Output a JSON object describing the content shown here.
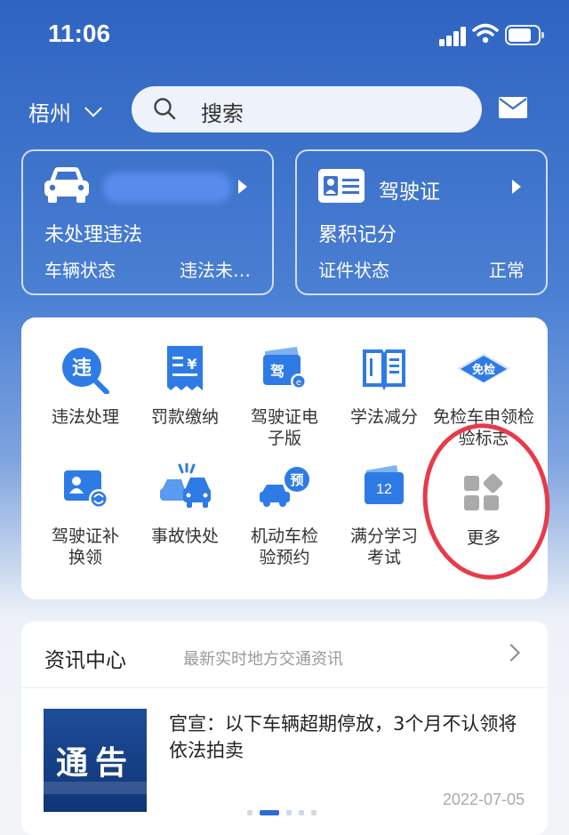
{
  "status_bar": {
    "time": "11:06",
    "battery_level": 0.8
  },
  "header": {
    "city": "梧州",
    "search_placeholder": "搜索"
  },
  "vehicle_card": {
    "title": "未处理违法",
    "status_label": "车辆状态",
    "status_value": "违法未…"
  },
  "license_card": {
    "name": "驾驶证",
    "title": "累积记分",
    "status_label": "证件状态",
    "status_value": "正常"
  },
  "services": [
    {
      "label": "违法处理",
      "icon": "violation-icon"
    },
    {
      "label": "罚款缴纳",
      "icon": "fine-payment-icon"
    },
    {
      "label": "驾驶证电子版",
      "icon": "e-license-icon"
    },
    {
      "label": "学法减分",
      "icon": "study-book-icon"
    },
    {
      "label": "免检车申领检验标志",
      "icon": "inspection-exempt-icon",
      "badge": "免检"
    },
    {
      "label": "驾驶证补换领",
      "icon": "license-replace-icon"
    },
    {
      "label": "事故快处",
      "icon": "accident-icon"
    },
    {
      "label": "机动车检验预约",
      "icon": "inspection-booking-icon",
      "badge": "预"
    },
    {
      "label": "满分学习考试",
      "icon": "full-score-exam-icon",
      "badge": "12"
    },
    {
      "label": "更多",
      "icon": "more-grid-icon"
    }
  ],
  "news": {
    "title": "资讯中心",
    "subtitle": "最新实时地方交通资讯",
    "headline": "官宣：以下车辆超期停放，3个月不认领将依法拍卖",
    "thumb_text": "通告",
    "date": "2022-07-05",
    "active_page": 2,
    "pages": 5
  },
  "colors": {
    "brand_blue": "#2f64c2",
    "accent": "#2f6bd6",
    "highlight_ring": "#e83a4a"
  }
}
